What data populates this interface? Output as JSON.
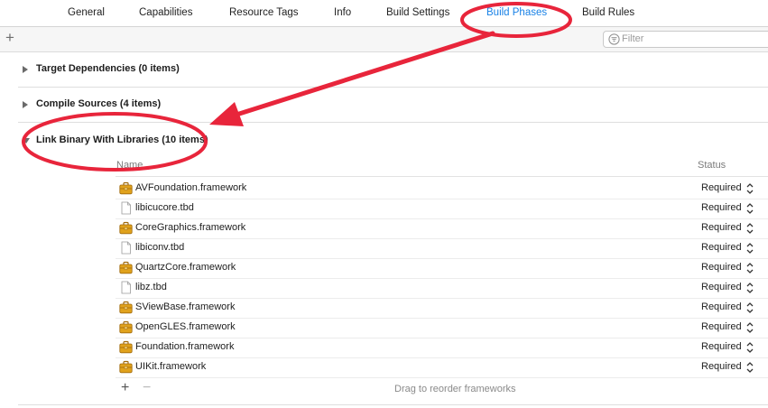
{
  "tabs": [
    {
      "label": "General"
    },
    {
      "label": "Capabilities"
    },
    {
      "label": "Resource Tags"
    },
    {
      "label": "Info"
    },
    {
      "label": "Build Settings"
    },
    {
      "label": "Build Phases"
    },
    {
      "label": "Build Rules"
    }
  ],
  "active_tab": "Build Phases",
  "toolbar": {
    "add_icon": "plus-icon",
    "filter_placeholder": "Filter",
    "filter_icon": "filter-icon"
  },
  "sections": {
    "target_dependencies": {
      "title": "Target Dependencies (0 items)",
      "state": "collapsed"
    },
    "compile_sources": {
      "title": "Compile Sources (4 items)",
      "state": "collapsed"
    },
    "link_binary": {
      "title": "Link Binary With Libraries (10 items)",
      "state": "expanded"
    }
  },
  "link_table": {
    "columns": {
      "name": "Name",
      "status": "Status"
    },
    "rows": [
      {
        "name": "AVFoundation.framework",
        "icon": "framework-toolbox-icon",
        "status": "Required"
      },
      {
        "name": "libicucore.tbd",
        "icon": "document-icon",
        "status": "Required"
      },
      {
        "name": "CoreGraphics.framework",
        "icon": "framework-toolbox-icon",
        "status": "Required"
      },
      {
        "name": "libiconv.tbd",
        "icon": "document-icon",
        "status": "Required"
      },
      {
        "name": "QuartzCore.framework",
        "icon": "framework-toolbox-icon",
        "status": "Required"
      },
      {
        "name": "libz.tbd",
        "icon": "document-icon",
        "status": "Required"
      },
      {
        "name": "SViewBase.framework",
        "icon": "framework-toolbox-icon",
        "status": "Required"
      },
      {
        "name": "OpenGLES.framework",
        "icon": "framework-toolbox-icon",
        "status": "Required"
      },
      {
        "name": "Foundation.framework",
        "icon": "framework-toolbox-icon",
        "status": "Required"
      },
      {
        "name": "UIKit.framework",
        "icon": "framework-toolbox-icon",
        "status": "Required"
      }
    ],
    "add_label": "+",
    "remove_label": "−",
    "hint": "Drag to reorder frameworks"
  },
  "colors": {
    "active_tab": "#1a82e6",
    "annotation": "#e8253b",
    "framework_icon": "#e0a21c"
  }
}
